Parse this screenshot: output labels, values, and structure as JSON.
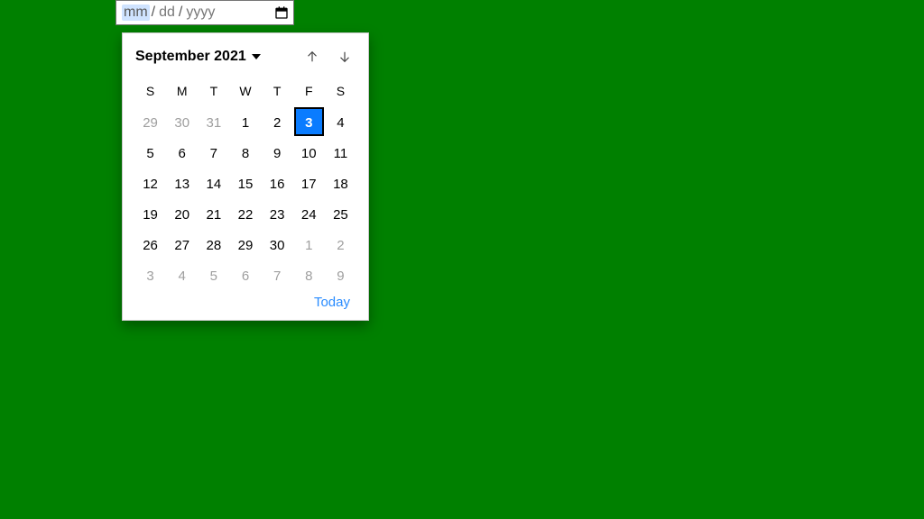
{
  "input": {
    "mm": "mm",
    "dd": "dd",
    "yyyy": "yyyy",
    "slash": "/"
  },
  "calendar": {
    "month_label": "September 2021",
    "weekdays": [
      "S",
      "M",
      "T",
      "W",
      "T",
      "F",
      "S"
    ],
    "days": [
      {
        "n": "29",
        "out": true
      },
      {
        "n": "30",
        "out": true
      },
      {
        "n": "31",
        "out": true
      },
      {
        "n": "1"
      },
      {
        "n": "2"
      },
      {
        "n": "3",
        "selected": true
      },
      {
        "n": "4"
      },
      {
        "n": "5"
      },
      {
        "n": "6"
      },
      {
        "n": "7"
      },
      {
        "n": "8"
      },
      {
        "n": "9"
      },
      {
        "n": "10"
      },
      {
        "n": "11"
      },
      {
        "n": "12"
      },
      {
        "n": "13"
      },
      {
        "n": "14"
      },
      {
        "n": "15"
      },
      {
        "n": "16"
      },
      {
        "n": "17"
      },
      {
        "n": "18"
      },
      {
        "n": "19"
      },
      {
        "n": "20"
      },
      {
        "n": "21"
      },
      {
        "n": "22"
      },
      {
        "n": "23"
      },
      {
        "n": "24"
      },
      {
        "n": "25"
      },
      {
        "n": "26"
      },
      {
        "n": "27"
      },
      {
        "n": "28"
      },
      {
        "n": "29"
      },
      {
        "n": "30"
      },
      {
        "n": "1",
        "out": true
      },
      {
        "n": "2",
        "out": true
      },
      {
        "n": "3",
        "out": true
      },
      {
        "n": "4",
        "out": true
      },
      {
        "n": "5",
        "out": true
      },
      {
        "n": "6",
        "out": true
      },
      {
        "n": "7",
        "out": true
      },
      {
        "n": "8",
        "out": true
      },
      {
        "n": "9",
        "out": true
      }
    ],
    "today_label": "Today"
  }
}
